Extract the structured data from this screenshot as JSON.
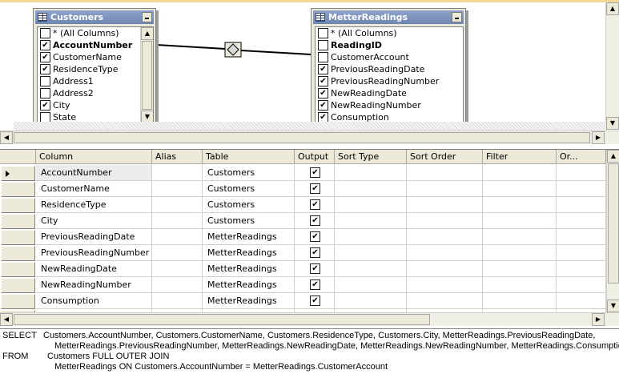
{
  "diagram": {
    "tables": [
      {
        "title": "Customers",
        "rows": [
          {
            "label": "* (All Columns)",
            "checked": false,
            "bold": false
          },
          {
            "label": "AccountNumber",
            "checked": true,
            "bold": true
          },
          {
            "label": "CustomerName",
            "checked": true,
            "bold": false
          },
          {
            "label": "ResidenceType",
            "checked": true,
            "bold": false
          },
          {
            "label": "Address1",
            "checked": false,
            "bold": false
          },
          {
            "label": "Address2",
            "checked": false,
            "bold": false
          },
          {
            "label": "City",
            "checked": true,
            "bold": false
          },
          {
            "label": "State",
            "checked": false,
            "bold": false
          }
        ]
      },
      {
        "title": "MetterReadings",
        "rows": [
          {
            "label": "* (All Columns)",
            "checked": false,
            "bold": false
          },
          {
            "label": "ReadingID",
            "checked": false,
            "bold": true
          },
          {
            "label": "CustomerAccount",
            "checked": false,
            "bold": false
          },
          {
            "label": "PreviousReadingDate",
            "checked": true,
            "bold": false
          },
          {
            "label": "PreviousReadingNumber",
            "checked": true,
            "bold": false
          },
          {
            "label": "NewReadingDate",
            "checked": true,
            "bold": false
          },
          {
            "label": "NewReadingNumber",
            "checked": true,
            "bold": false
          },
          {
            "label": "Consumption",
            "checked": true,
            "bold": false
          }
        ]
      }
    ]
  },
  "grid": {
    "headers": [
      "Column",
      "Alias",
      "Table",
      "Output",
      "Sort Type",
      "Sort Order",
      "Filter",
      "Or..."
    ],
    "rows": [
      {
        "column": "AccountNumber",
        "alias": "",
        "table": "Customers",
        "output": true
      },
      {
        "column": "CustomerName",
        "alias": "",
        "table": "Customers",
        "output": true
      },
      {
        "column": "ResidenceType",
        "alias": "",
        "table": "Customers",
        "output": true
      },
      {
        "column": "City",
        "alias": "",
        "table": "Customers",
        "output": true
      },
      {
        "column": "PreviousReadingDate",
        "alias": "",
        "table": "MetterReadings",
        "output": true
      },
      {
        "column": "PreviousReadingNumber",
        "alias": "",
        "table": "MetterReadings",
        "output": true
      },
      {
        "column": "NewReadingDate",
        "alias": "",
        "table": "MetterReadings",
        "output": true
      },
      {
        "column": "NewReadingNumber",
        "alias": "",
        "table": "MetterReadings",
        "output": true
      },
      {
        "column": "Consumption",
        "alias": "",
        "table": "MetterReadings",
        "output": true
      }
    ]
  },
  "sql": {
    "keyword_select": "SELECT",
    "select_line1": "Customers.AccountNumber, Customers.CustomerName, Customers.ResidenceType, Customers.City, MetterReadings.PreviousReadingDate,",
    "select_line2": "MetterReadings.PreviousReadingNumber, MetterReadings.NewReadingDate, MetterReadings.NewReadingNumber, MetterReadings.Consumption",
    "keyword_from": "FROM",
    "from_line1": "Customers FULL OUTER JOIN",
    "from_line2": "MetterReadings ON Customers.AccountNumber = MetterReadings.CustomerAccount"
  },
  "icons": {
    "scroll_up": "▲",
    "scroll_down": "▼",
    "scroll_left": "◀",
    "scroll_right": "▶",
    "check": "✔"
  },
  "colors": {
    "title_bar": "#7f95bf",
    "chrome": "#ece9d8",
    "top_accent": "#f5d89b"
  }
}
